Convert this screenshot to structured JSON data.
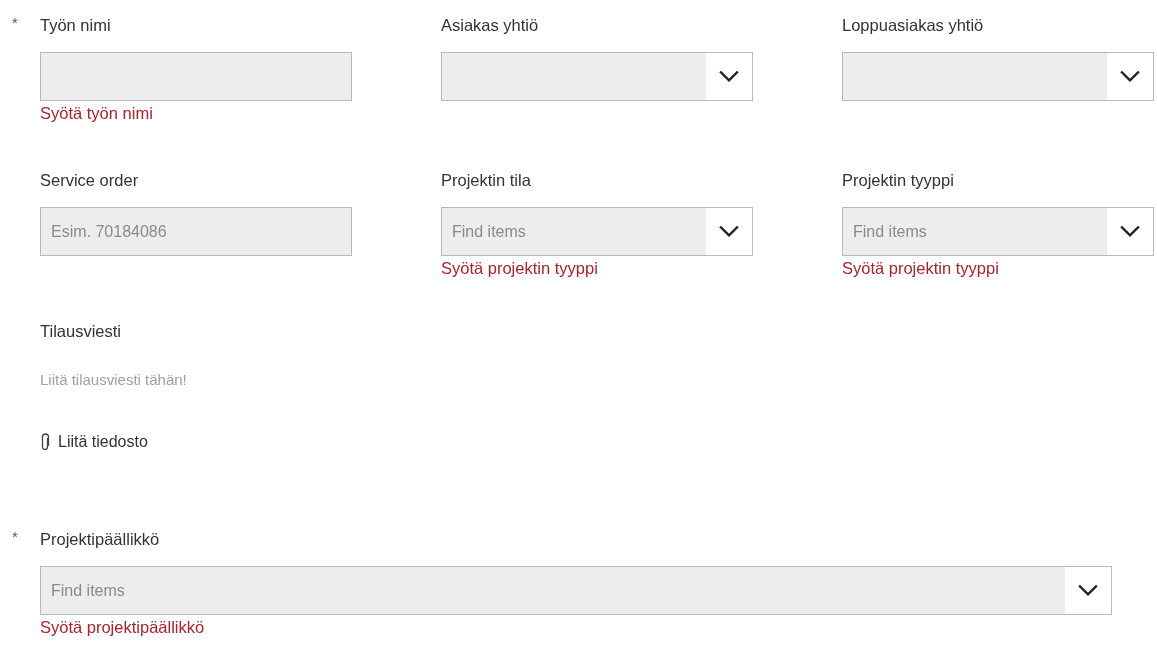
{
  "rows": [
    {
      "fields": [
        {
          "kind": "text",
          "label": "Työn nimi",
          "required_mark": "*",
          "error": "Syötä työn nimi"
        },
        {
          "kind": "dropdown",
          "label": "Asiakas yhtiö"
        },
        {
          "kind": "dropdown",
          "label": "Loppuasiakas yhtiö"
        }
      ]
    },
    {
      "fields": [
        {
          "kind": "text",
          "label": "Service order",
          "placeholder": "Esim. 70184086"
        },
        {
          "kind": "dropdown",
          "label": "Projektin tila",
          "placeholder": "Find items",
          "error": "Syötä projektin tyyppi"
        },
        {
          "kind": "dropdown",
          "label": "Projektin tyyppi",
          "placeholder": "Find items",
          "error": "Syötä projektin tyyppi"
        }
      ]
    }
  ],
  "message": {
    "label": "Tilausviesti",
    "placeholder": "Liitä tilausviesti tähän!",
    "attach": "Liitä tiedosto"
  },
  "manager": {
    "label": "Projektipäällikkö",
    "required_mark": "*",
    "placeholder": "Find items",
    "error": "Syötä projektipäällikkö"
  }
}
